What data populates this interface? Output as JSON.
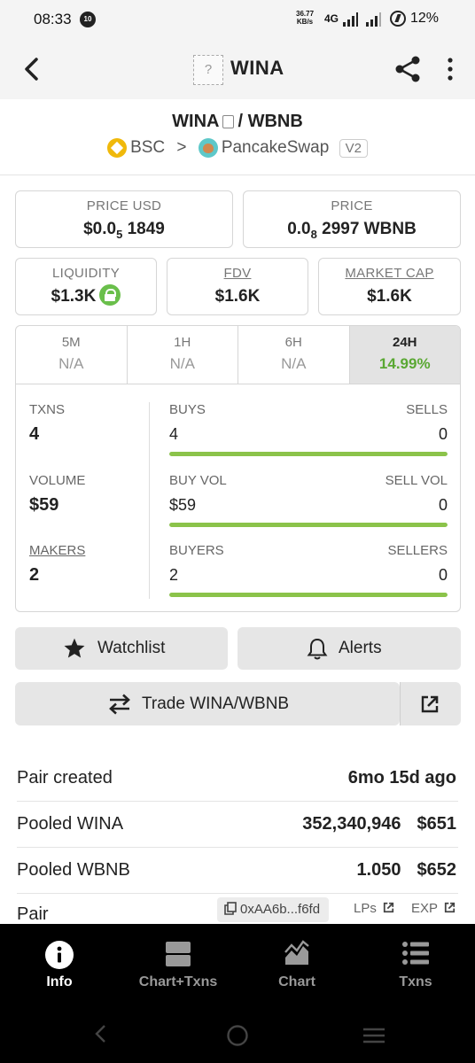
{
  "status_bar": {
    "time": "08:33",
    "notification_badge": "10",
    "net_speed_value": "36.77",
    "net_speed_unit": "KB/s",
    "network_type": "4G",
    "battery": "12%"
  },
  "app_bar": {
    "token_placeholder": "?",
    "title": "WINA"
  },
  "pair": {
    "base": "WINA",
    "separator": "/",
    "quote": "WBNB",
    "chain": "BSC",
    "arrow": ">",
    "dex": "PancakeSwap",
    "version": "V2"
  },
  "stats": {
    "price_usd_label": "PRICE USD",
    "price_usd_prefix": "$0.0",
    "price_usd_sub": "5",
    "price_usd_rest": "1849",
    "price_label": "PRICE",
    "price_prefix": "0.0",
    "price_sub": "8",
    "price_rest": "2997 WBNB",
    "liquidity_label": "LIQUIDITY",
    "liquidity_value": "$1.3K",
    "fdv_label": "FDV",
    "fdv_value": "$1.6K",
    "mcap_label": "MARKET CAP",
    "mcap_value": "$1.6K"
  },
  "timeframes": [
    {
      "label": "5M",
      "change": "N/A"
    },
    {
      "label": "1H",
      "change": "N/A"
    },
    {
      "label": "6H",
      "change": "N/A"
    },
    {
      "label": "24H",
      "change": "14.99%"
    }
  ],
  "metrics": {
    "txns_label": "TXNS",
    "txns_value": "4",
    "volume_label": "VOLUME",
    "volume_value": "$59",
    "makers_label": "MAKERS",
    "makers_value": "2",
    "buys_label": "BUYS",
    "buys_value": "4",
    "sells_label": "SELLS",
    "sells_value": "0",
    "buy_vol_label": "BUY VOL",
    "buy_vol_value": "$59",
    "sell_vol_label": "SELL VOL",
    "sell_vol_value": "0",
    "buyers_label": "BUYERS",
    "buyers_value": "2",
    "sellers_label": "SELLERS",
    "sellers_value": "0",
    "buys_ratio": 1.0,
    "buy_vol_ratio": 1.0,
    "buyers_ratio": 1.0
  },
  "actions": {
    "watchlist": "Watchlist",
    "alerts": "Alerts",
    "trade": "Trade WINA/WBNB"
  },
  "info": {
    "pair_created_label": "Pair created",
    "pair_created_value": "6mo 15d ago",
    "pooled_base_label": "Pooled WINA",
    "pooled_base_amount": "352,340,946",
    "pooled_base_usd": "$651",
    "pooled_quote_label": "Pooled WBNB",
    "pooled_quote_amount": "1.050",
    "pooled_quote_usd": "$652",
    "pair_label": "Pair",
    "pair_address": "0xAA6b...f6fd",
    "lps_link": "LPs",
    "exp_link": "EXP"
  },
  "bottom_nav": [
    {
      "label": "Info",
      "icon": "info-icon",
      "active": true
    },
    {
      "label": "Chart+Txns",
      "icon": "chart-txns-icon",
      "active": false
    },
    {
      "label": "Chart",
      "icon": "chart-icon",
      "active": false
    },
    {
      "label": "Txns",
      "icon": "list-icon",
      "active": false
    }
  ],
  "colors": {
    "positive": "#5aa833",
    "bar_fill": "#8bc34a",
    "bsc_yellow": "#f0b90b"
  }
}
